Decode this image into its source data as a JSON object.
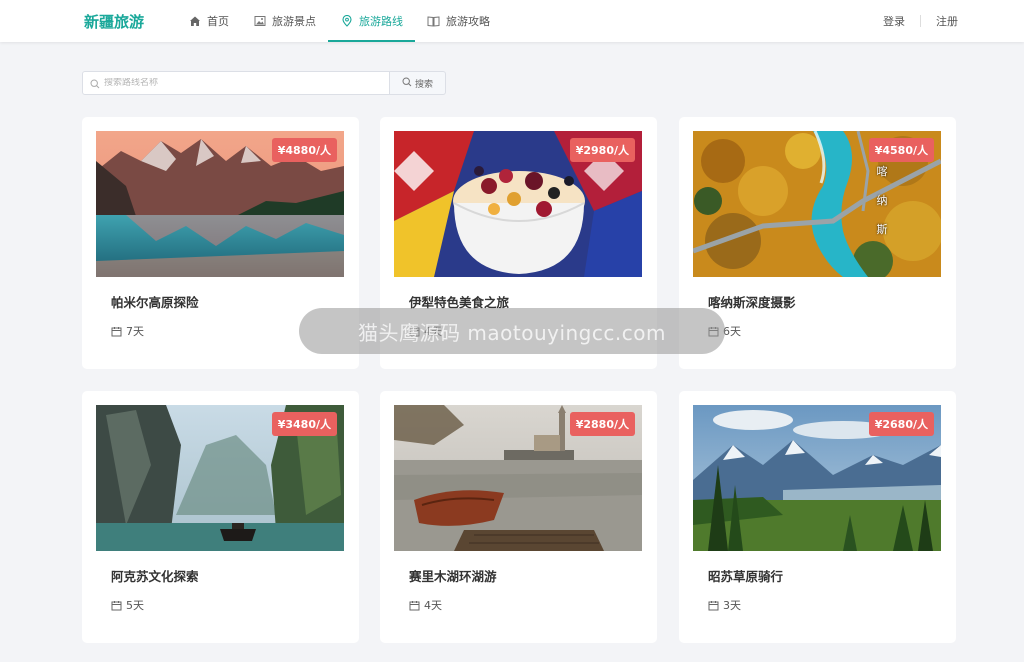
{
  "brand": "新疆旅游",
  "nav": [
    {
      "label": "首页",
      "icon": "home-icon"
    },
    {
      "label": "旅游景点",
      "icon": "image-icon"
    },
    {
      "label": "旅游路线",
      "icon": "location-pin-icon",
      "active": true
    },
    {
      "label": "旅游攻略",
      "icon": "book-icon"
    }
  ],
  "auth": {
    "login": "登录",
    "register": "注册"
  },
  "search": {
    "placeholder": "搜索路线名称",
    "button": "搜索"
  },
  "routes": [
    {
      "title": "帕米尔高原探险",
      "price": "¥4880/人",
      "days": "7天",
      "image": "mountain-lake"
    },
    {
      "title": "伊犁特色美食之旅",
      "price": "¥2980/人",
      "days": "4天",
      "image": "food-bowl"
    },
    {
      "title": "喀纳斯深度摄影",
      "price": "¥4580/人",
      "days": "6天",
      "image": "river-valley",
      "overlay": [
        "喀",
        "纳",
        "斯"
      ]
    },
    {
      "title": "阿克苏文化探索",
      "price": "¥3480/人",
      "days": "5天",
      "image": "gorge-boat"
    },
    {
      "title": "赛里木湖环湖游",
      "price": "¥2880/人",
      "days": "4天",
      "image": "lake-rowboat"
    },
    {
      "title": "昭苏草原骑行",
      "price": "¥2680/人",
      "days": "3天",
      "image": "grassland-mountains"
    }
  ],
  "watermark": "猫头鹰源码 maotouyingcc.com",
  "colors": {
    "accent": "#1aa89a",
    "price_badge": "#e9615f"
  }
}
